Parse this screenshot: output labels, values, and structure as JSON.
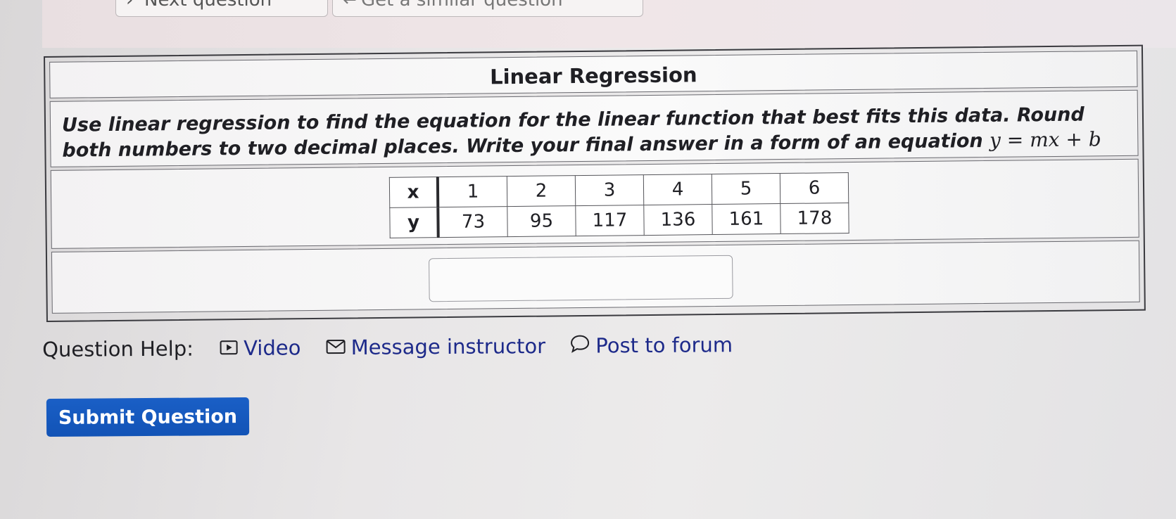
{
  "nav": {
    "next_label": "Next question",
    "similar_label": "Get a similar question"
  },
  "question": {
    "title": "Linear Regression",
    "instructions": "Use linear regression to find the equation for the linear function that best fits this data. Round both numbers to two decimal places. Write your final answer in a form of an equation ",
    "equation": "y = mx + b",
    "table": {
      "x_label": "x",
      "y_label": "y",
      "x_values": [
        "1",
        "2",
        "3",
        "4",
        "5",
        "6"
      ],
      "y_values": [
        "73",
        "95",
        "117",
        "136",
        "161",
        "178"
      ]
    },
    "answer_value": ""
  },
  "help": {
    "label": "Question Help:",
    "video": "Video",
    "message": "Message instructor",
    "forum": "Post to forum"
  },
  "submit_label": "Submit Question",
  "colors": {
    "link": "#1d2a8a",
    "submit_bg": "#1459bf"
  },
  "icons": [
    "video-icon",
    "mail-icon",
    "speech-bubble-icon"
  ]
}
